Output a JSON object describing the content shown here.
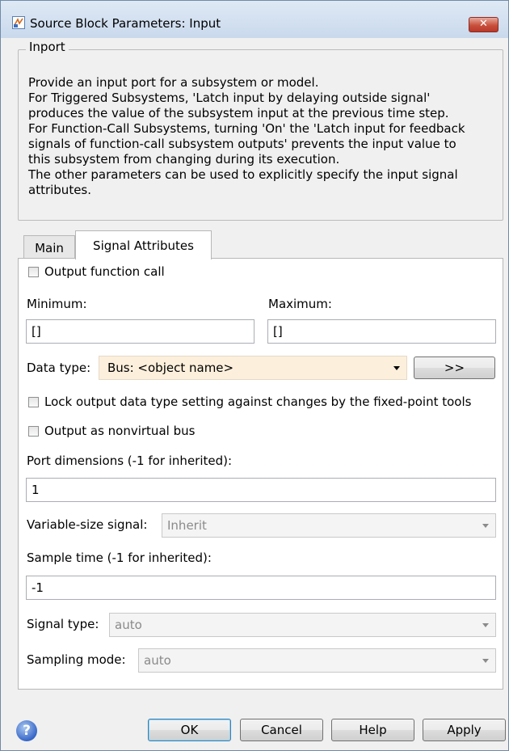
{
  "window": {
    "title": "Source Block Parameters: Input",
    "close_glyph": "✕"
  },
  "group": {
    "legend": "Inport",
    "description_lines": [
      "Provide an input port for a subsystem or model.",
      "For Triggered Subsystems, 'Latch input by delaying outside signal'",
      "produces the value of the subsystem input at the previous time step.",
      "For Function-Call Subsystems, turning 'On' the 'Latch input for feedback",
      "signals of function-call subsystem outputs' prevents the input value to",
      "this subsystem from changing during its execution.",
      "The other parameters can be used to explicitly specify the input signal",
      "attributes."
    ]
  },
  "tabs": [
    {
      "label": "Main",
      "selected": false
    },
    {
      "label": "Signal Attributes",
      "selected": true
    }
  ],
  "signal_attributes": {
    "output_function_call": {
      "label": "Output function call",
      "checked": false
    },
    "minimum": {
      "label": "Minimum:",
      "value": "[]"
    },
    "maximum": {
      "label": "Maximum:",
      "value": "[]"
    },
    "data_type": {
      "label": "Data type:",
      "value": "Bus: <object name>",
      "assistant_label": ">>"
    },
    "lock_output": {
      "label": "Lock output data type setting against changes by the fixed-point tools",
      "checked": false
    },
    "nonvirtual_bus": {
      "label": "Output as nonvirtual bus",
      "checked": false
    },
    "port_dimensions": {
      "label": "Port dimensions (-1 for inherited):",
      "value": "1"
    },
    "variable_size": {
      "label": "Variable-size signal:",
      "value": "Inherit",
      "enabled": false
    },
    "sample_time": {
      "label": "Sample time (-1 for inherited):",
      "value": "-1"
    },
    "signal_type": {
      "label": "Signal type:",
      "value": "auto",
      "enabled": false
    },
    "sampling_mode": {
      "label": "Sampling mode:",
      "value": "auto",
      "enabled": false
    }
  },
  "buttons": {
    "help_glyph": "?",
    "ok": "OK",
    "cancel": "Cancel",
    "help": "Help",
    "apply": "Apply"
  },
  "colors": {
    "window_bg": "#f0f0f0",
    "data_type_highlight": "#fcefdc",
    "close_button": "#c8503c"
  }
}
